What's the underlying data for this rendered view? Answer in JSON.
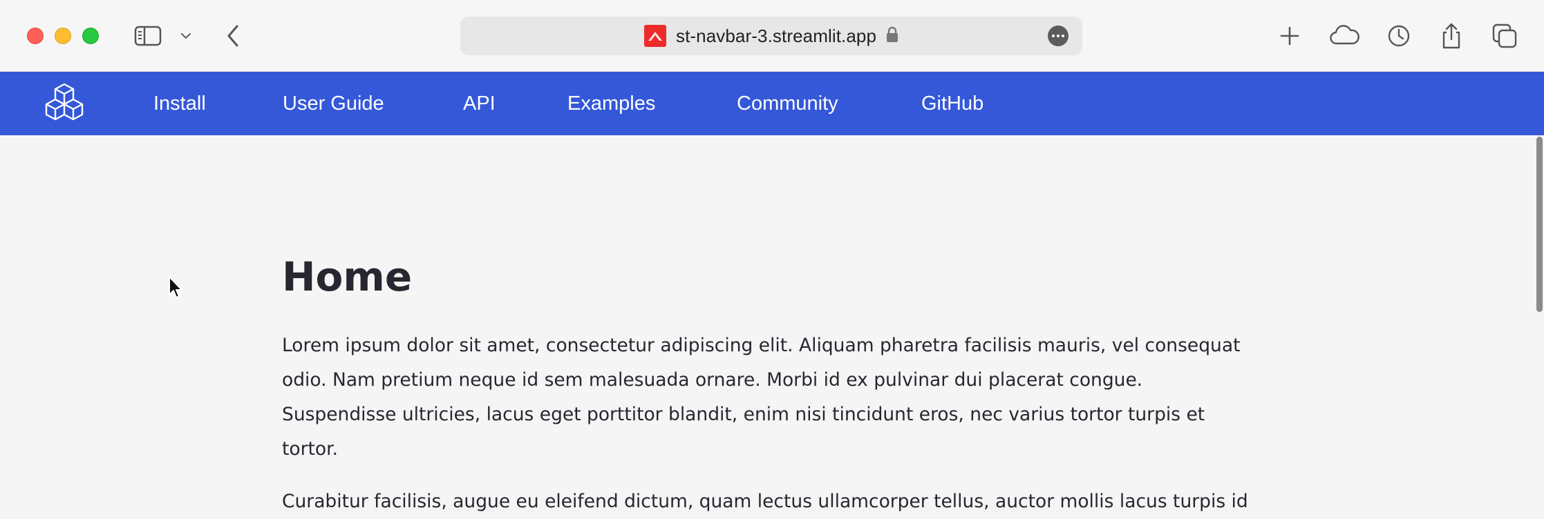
{
  "browser": {
    "url": "st-navbar-3.streamlit.app",
    "icons": {
      "sidebar": "sidebar-icon",
      "tabs_dropdown": "chevron-down-icon",
      "back": "chevron-left-icon",
      "secure": "lock-icon",
      "more": "more-icon",
      "new_tab": "plus-icon",
      "icloud": "cloud-icon",
      "history": "clock-icon",
      "share": "share-icon",
      "tab_overview": "tabs-icon"
    }
  },
  "navbar": {
    "color": "#3558d8",
    "logo": "cubes-logo-icon",
    "items": [
      {
        "label": "Install"
      },
      {
        "label": "User Guide"
      },
      {
        "label": "API"
      },
      {
        "label": "Examples"
      },
      {
        "label": "Community"
      },
      {
        "label": "GitHub"
      }
    ]
  },
  "main": {
    "title": "Home",
    "paragraphs": [
      "Lorem ipsum dolor sit amet, consectetur adipiscing elit. Aliquam pharetra facilisis mauris, vel consequat odio. Nam pretium neque id sem malesuada ornare. Morbi id ex pulvinar dui placerat congue. Suspendisse ultricies, lacus eget porttitor blandit, enim nisi tincidunt eros, nec varius tortor turpis et tortor.",
      "Curabitur facilisis, augue eu eleifend dictum, quam lectus ullamcorper tellus, auctor mollis lacus turpis id"
    ]
  }
}
